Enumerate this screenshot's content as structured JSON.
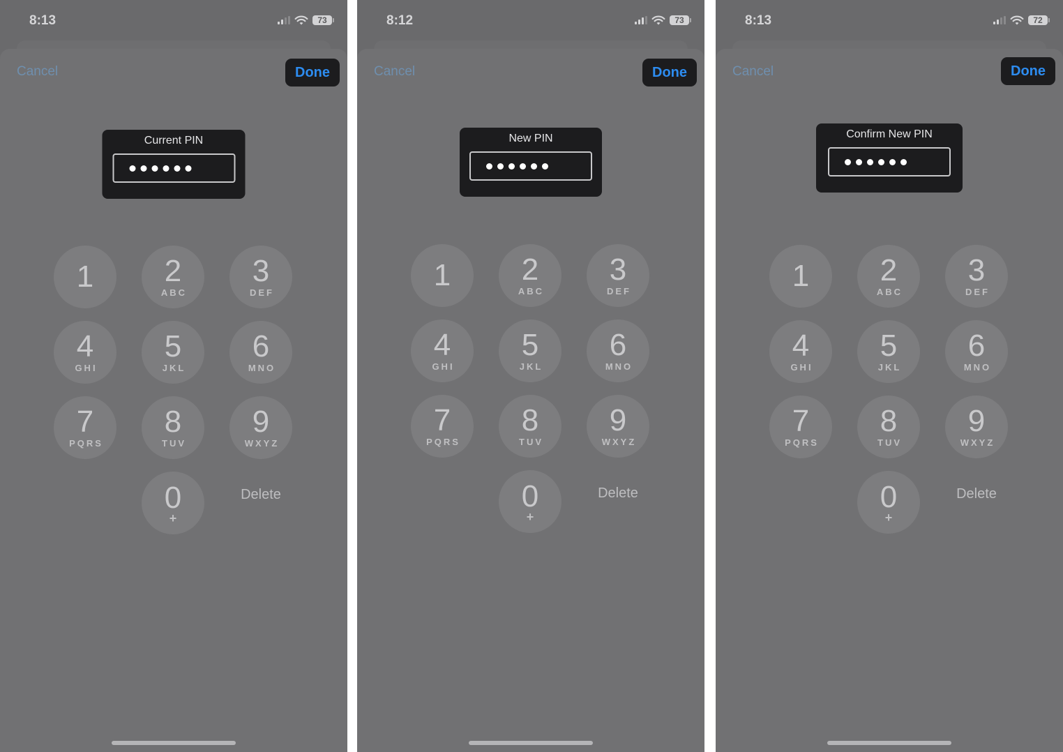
{
  "screens": [
    {
      "status": {
        "time": "8:13",
        "battery": "73",
        "signal_bars": 2
      },
      "nav": {
        "cancel_label": "Cancel",
        "done_label": "Done"
      },
      "pin": {
        "label": "Current PIN",
        "entered_digits": 6
      }
    },
    {
      "status": {
        "time": "8:12",
        "battery": "73",
        "signal_bars": 3
      },
      "nav": {
        "cancel_label": "Cancel",
        "done_label": "Done"
      },
      "pin": {
        "label": "New PIN",
        "entered_digits": 6
      }
    },
    {
      "status": {
        "time": "8:13",
        "battery": "72",
        "signal_bars": 2
      },
      "nav": {
        "cancel_label": "Cancel",
        "done_label": "Done"
      },
      "pin": {
        "label": "Confirm New PIN",
        "entered_digits": 6
      }
    }
  ],
  "keypad": {
    "keys": [
      {
        "num": "1",
        "letters": ""
      },
      {
        "num": "2",
        "letters": "ABC"
      },
      {
        "num": "3",
        "letters": "DEF"
      },
      {
        "num": "4",
        "letters": "GHI"
      },
      {
        "num": "5",
        "letters": "JKL"
      },
      {
        "num": "6",
        "letters": "MNO"
      },
      {
        "num": "7",
        "letters": "PQRS"
      },
      {
        "num": "8",
        "letters": "TUV"
      },
      {
        "num": "9",
        "letters": "WXYZ"
      },
      {
        "num": "0",
        "letters": "+"
      }
    ],
    "delete_label": "Delete"
  },
  "colors": {
    "accent": "#2d8cf0",
    "cancel_dimmed": "#6f8fae",
    "background_dim": "#6a6a6c",
    "card": "#1c1c1e"
  }
}
